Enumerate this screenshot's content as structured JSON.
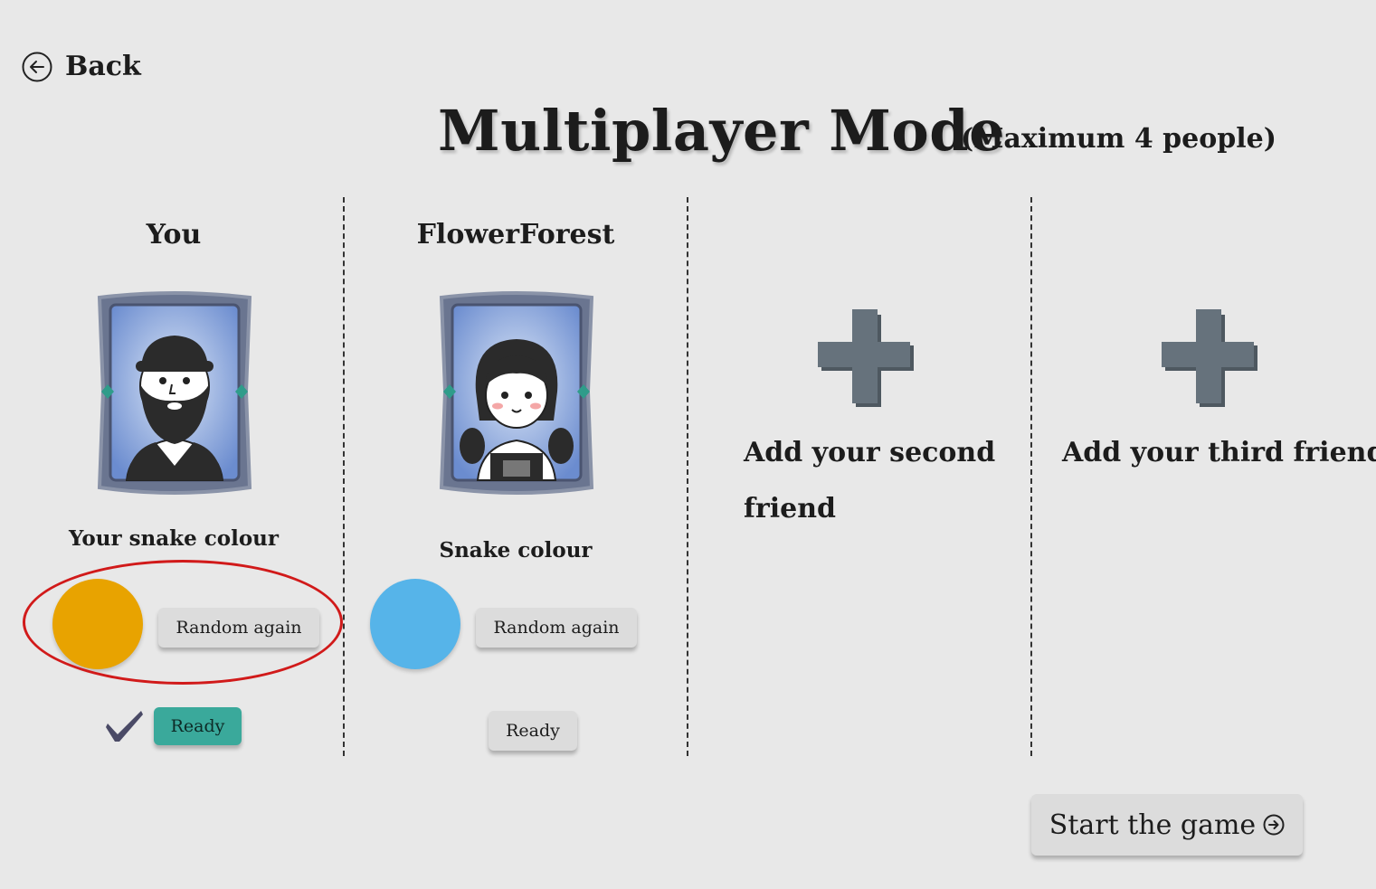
{
  "nav": {
    "back_label": "Back",
    "back_icon": "arrow-left-circle-icon"
  },
  "title": "Multiplayer Mode",
  "subtitle": "(Maximum 4 people)",
  "players": [
    {
      "name": "You",
      "avatar": "bearded-man-avatar",
      "colour_label": "Your snake colour",
      "snake_colour": "#e8a300",
      "random_label": "Random again",
      "ready_label": "Ready",
      "ready": true
    },
    {
      "name": "FlowerForest",
      "avatar": "girl-with-braids-avatar",
      "colour_label": "Snake colour",
      "snake_colour": "#56b4e9",
      "random_label": "Random again",
      "ready_label": "Ready",
      "ready": false
    }
  ],
  "empty_slots": [
    {
      "label": "Add your second friend",
      "icon": "plus-icon"
    },
    {
      "label": "Add your third friend",
      "icon": "plus-icon"
    }
  ],
  "start_label": "Start the game",
  "start_icon": "arrow-right-circle-icon",
  "colors": {
    "background": "#e8e8e8",
    "ready_active": "#3aa99b",
    "highlight_ring": "#d11a1a",
    "plus": "#66727c"
  }
}
